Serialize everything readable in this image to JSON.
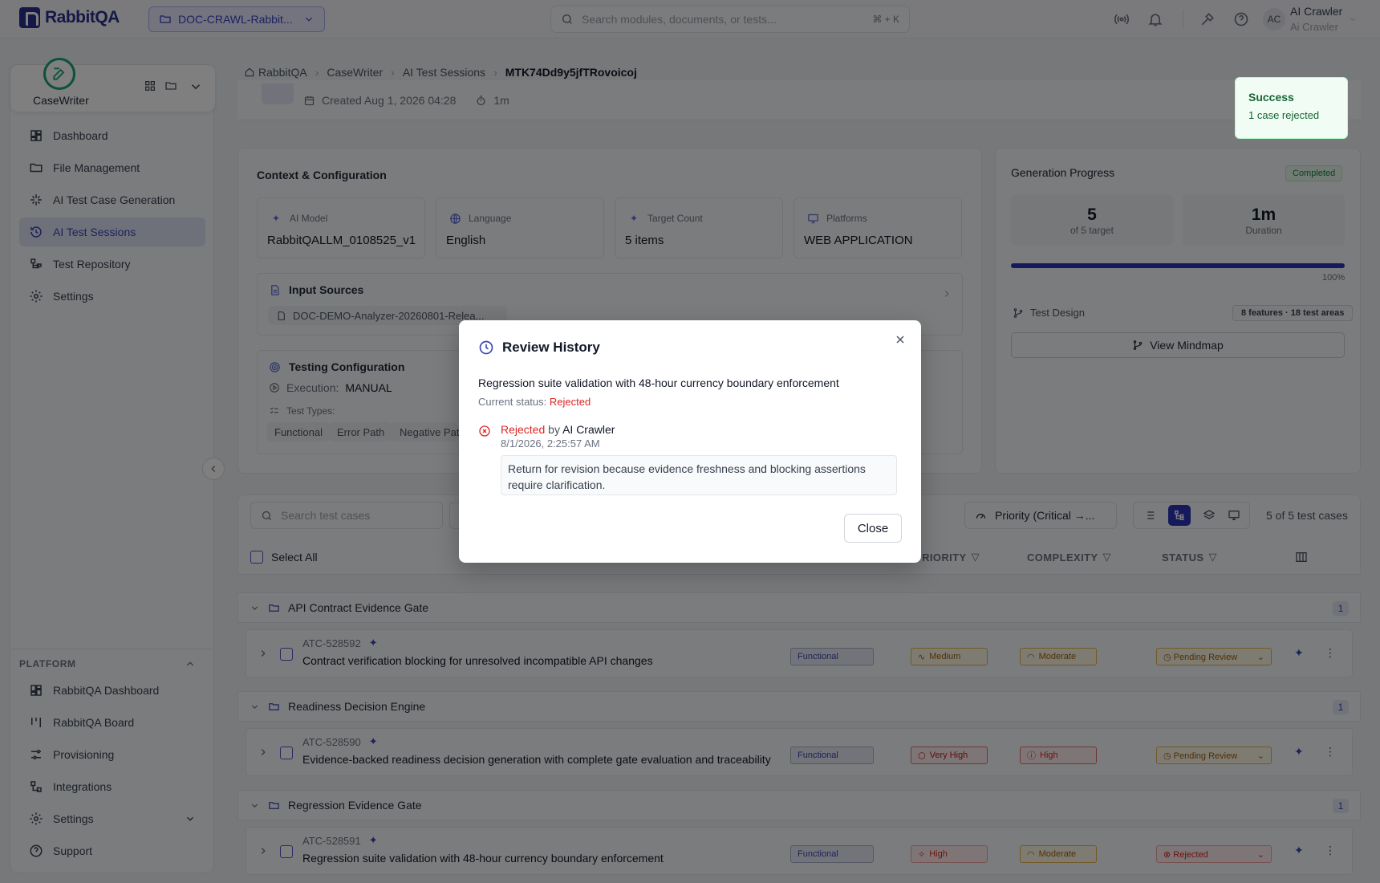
{
  "app": {
    "brand": "RabbitQA",
    "project": "DOC-CRAWL-Rabbit...",
    "search_placeholder": "Search modules, documents, or tests...",
    "search_shortcut": "⌘ + K",
    "user_initials": "AC",
    "user_name": "AI Crawler",
    "user_sub": "Ai Crawler"
  },
  "sidebar": {
    "app_name": "CaseWriter",
    "items": [
      {
        "label": "Dashboard",
        "icon": "dashboard-icon"
      },
      {
        "label": "File Management",
        "icon": "folder-icon"
      },
      {
        "label": "AI Test Case Generation",
        "icon": "sparkle-icon"
      },
      {
        "label": "AI Test Sessions",
        "icon": "history-icon",
        "active": true
      },
      {
        "label": "Test Repository",
        "icon": "repository-icon"
      },
      {
        "label": "Settings",
        "icon": "gear-icon"
      }
    ],
    "platform_title": "PLATFORM",
    "platform_items": [
      {
        "label": "RabbitQA Dashboard"
      },
      {
        "label": "RabbitQA Board"
      },
      {
        "label": "Provisioning"
      },
      {
        "label": "Integrations"
      },
      {
        "label": "Settings"
      },
      {
        "label": "Support"
      }
    ]
  },
  "breadcrumb": [
    "RabbitQA",
    "CaseWriter",
    "AI Test Sessions",
    "MTK74Dd9y5jfTRovoicoj"
  ],
  "session": {
    "created": "Created Aug 1, 2026 04:28",
    "duration": "1m"
  },
  "config": {
    "title": "Context & Configuration",
    "cards": [
      {
        "label": "AI Model",
        "value": "RabbitQALLM_0108525_v1"
      },
      {
        "label": "Language",
        "value": "English"
      },
      {
        "label": "Target Count",
        "value": "5 items"
      },
      {
        "label": "Platforms",
        "value": "WEB APPLICATION"
      }
    ],
    "input_sources_title": "Input Sources",
    "input_doc": "DOC-DEMO-Analyzer-20260801-Relea...",
    "testing_title": "Testing Configuration",
    "execution_label": "Execution:",
    "execution_value": "MANUAL",
    "types_label": "Test Types:",
    "types": [
      "Functional",
      "Error Path",
      "Negative Pat"
    ]
  },
  "generation": {
    "title": "Generation Progress",
    "status": "Completed",
    "generated": "5",
    "generated_sub": "of 5 target",
    "duration": "1m",
    "duration_sub": "Duration",
    "progress": 1.0,
    "progress_label": "100%",
    "design_label": "Test Design",
    "design_tag": "8 features · 18 test areas",
    "mindmap_btn": "View Mindmap"
  },
  "table": {
    "search_placeholder": "Search test cases",
    "sort": "Priority (Critical →...",
    "count": "5 of 5 test cases",
    "select_all": "Select All",
    "col_priority": "PRIORITY",
    "col_complexity": "COMPLEXITY",
    "col_status": "STATUS",
    "groups": [
      {
        "name": "API Contract Evidence Gate",
        "count": "1",
        "row": {
          "id": "ATC-528592",
          "title": "Contract verification blocking for unresolved incompatible API changes",
          "type": "Functional",
          "priority": "Medium",
          "complexity": "Moderate",
          "status": "Pending Review"
        }
      },
      {
        "name": "Readiness Decision Engine",
        "count": "1",
        "row": {
          "id": "ATC-528590",
          "title": "Evidence-backed readiness decision generation with complete gate evaluation and traceability",
          "type": "Functional",
          "priority": "Very High",
          "complexity": "High",
          "status": "Pending Review"
        }
      },
      {
        "name": "Regression Evidence Gate",
        "count": "1",
        "row": {
          "id": "ATC-528591",
          "title": "Regression suite validation with 48-hour currency boundary enforcement",
          "type": "Functional",
          "priority": "High",
          "complexity": "Moderate",
          "status": "Rejected"
        }
      }
    ]
  },
  "modal": {
    "title": "Review History",
    "case_title": "Regression suite validation with 48-hour currency boundary enforcement",
    "current_label": "Current status:",
    "current_value": "Rejected",
    "event_action": "Rejected",
    "event_by": "by",
    "event_user": "AI Crawler",
    "event_time": "8/1/2026, 2:25:57 AM",
    "event_note": "Return for revision because evidence freshness and blocking assertions require clarification.",
    "close_label": "Close"
  },
  "toast": {
    "title": "Success",
    "message": "1 case rejected"
  }
}
